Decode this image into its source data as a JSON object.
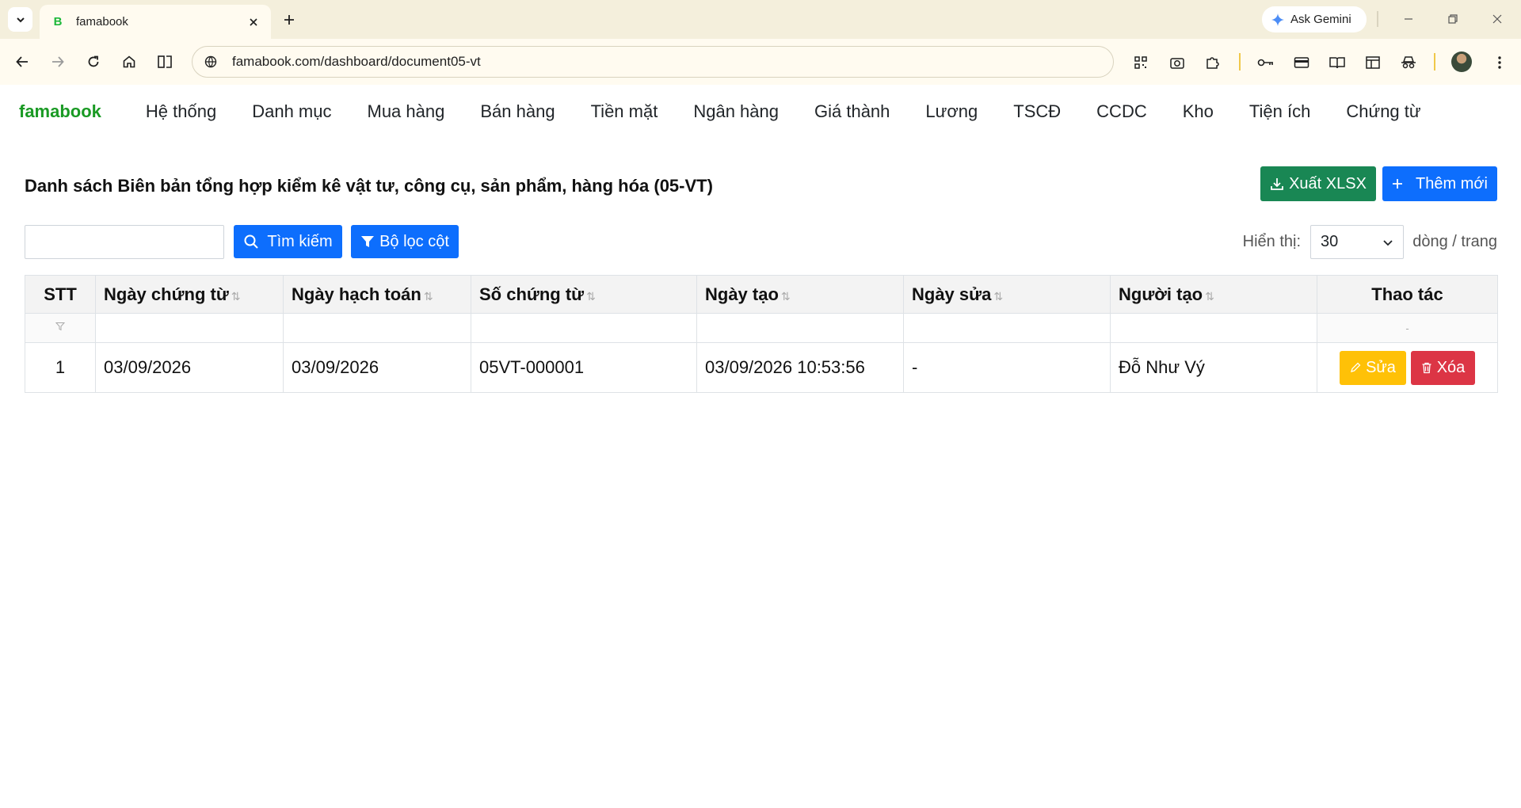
{
  "browser": {
    "tab_title": "famabook",
    "tab_favicon": "B",
    "url": "famabook.com/dashboard/document05-vt",
    "gemini_label": "Ask Gemini"
  },
  "app": {
    "brand": "famabook",
    "nav": [
      "Hệ thống",
      "Danh mục",
      "Mua hàng",
      "Bán hàng",
      "Tiền mặt",
      "Ngân hàng",
      "Giá thành",
      "Lương",
      "TSCĐ",
      "CCDC",
      "Kho",
      "Tiện ích",
      "Chứng từ"
    ],
    "page_title": "Danh sách Biên bản tổng hợp kiểm kê vật tư, công cụ, sản phẩm, hàng hóa (05-VT)",
    "export_label": "Xuất XLSX",
    "add_label": "Thêm mới",
    "search_value": "",
    "search_button": "Tìm kiếm",
    "column_filter_button": "Bộ lọc cột",
    "show_label": "Hiển thị:",
    "page_size": "30",
    "rows_label": "dòng / trang",
    "table": {
      "headers": [
        "STT",
        "Ngày chứng từ",
        "Ngày hạch toán",
        "Số chứng từ",
        "Ngày tạo",
        "Ngày sửa",
        "Người tạo",
        "Thao tác"
      ],
      "action_filter_placeholder": "-",
      "rows": [
        {
          "stt": "1",
          "ngay_chung_tu": "03/09/2026",
          "ngay_hach_toan": "03/09/2026",
          "so_chung_tu": "05VT-000001",
          "ngay_tao": "03/09/2026 10:53:56",
          "ngay_sua": "-",
          "nguoi_tao": "Đỗ Như Vý",
          "edit_label": "Sửa",
          "delete_label": "Xóa"
        }
      ]
    }
  },
  "colors": {
    "brand": "#1a9a24",
    "primary": "#0d6efd",
    "success": "#198754",
    "warning": "#ffc107",
    "danger": "#dc3545",
    "chrome_bg": "#f4efdc"
  }
}
